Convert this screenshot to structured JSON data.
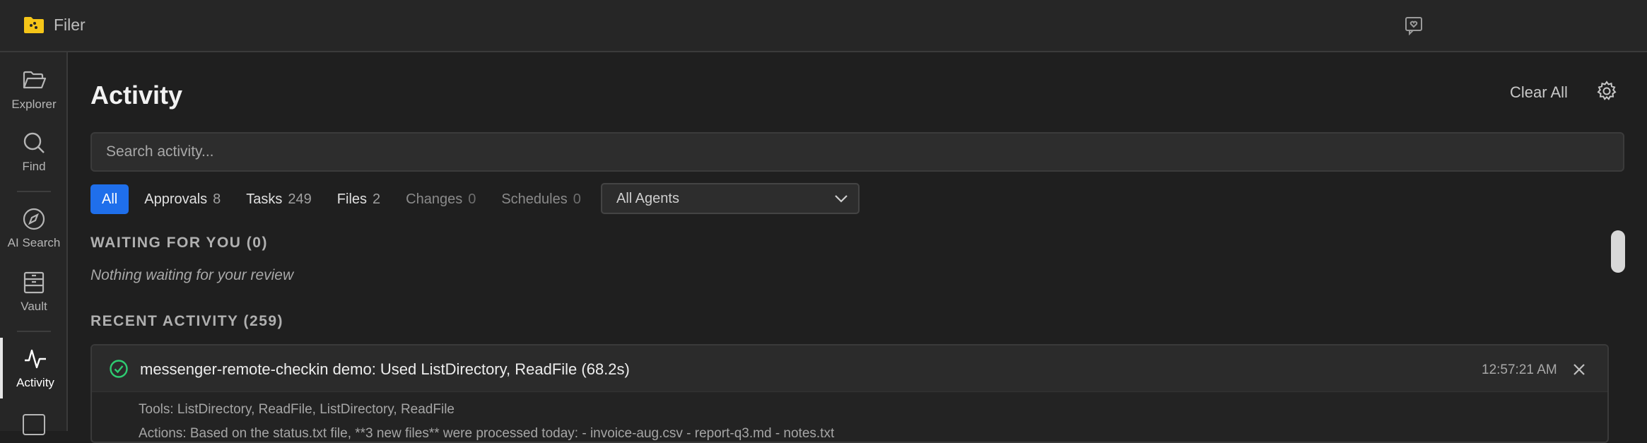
{
  "app": {
    "title": "Filer"
  },
  "sidebar": {
    "items": [
      {
        "label": "Explorer",
        "icon": "folder-open-icon"
      },
      {
        "label": "Find",
        "icon": "search-icon"
      },
      {
        "label": "AI Search",
        "icon": "compass-icon"
      },
      {
        "label": "Vault",
        "icon": "archive-icon"
      },
      {
        "label": "Activity",
        "icon": "activity-icon",
        "active": true
      }
    ]
  },
  "header": {
    "title": "Activity",
    "clear_all": "Clear All",
    "settings_icon": "gear-icon"
  },
  "search": {
    "placeholder": "Search activity..."
  },
  "filters": {
    "all": "All",
    "approvals": {
      "label": "Approvals",
      "count": "8"
    },
    "tasks": {
      "label": "Tasks",
      "count": "249"
    },
    "files": {
      "label": "Files",
      "count": "2"
    },
    "changes": {
      "label": "Changes",
      "count": "0"
    },
    "schedules": {
      "label": "Schedules",
      "count": "0"
    },
    "agents_selected": "All Agents"
  },
  "waiting": {
    "heading": "WAITING FOR YOU (0)",
    "empty": "Nothing waiting for your review"
  },
  "recent": {
    "heading": "RECENT ACTIVITY (259)",
    "items": [
      {
        "title": "messenger-remote-checkin demo: Used ListDirectory, ReadFile (68.2s)",
        "time": "12:57:21 AM",
        "tools": "Tools: ListDirectory, ReadFile, ListDirectory, ReadFile",
        "actions": "Actions: Based on the status.txt file, **3 new files** were processed today: - invoice-aug.csv - report-q3.md - notes.txt"
      }
    ]
  },
  "colors": {
    "accent": "#1f6feb",
    "success": "#2ecc71",
    "folder": "#f5c518"
  }
}
